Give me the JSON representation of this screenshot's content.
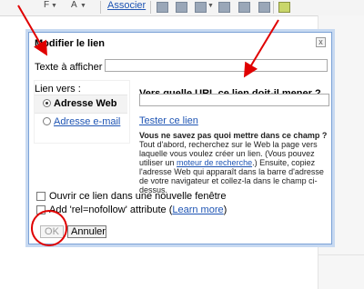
{
  "toolbar": {
    "size_glyph": "F",
    "color_glyph": "A",
    "link_label": "Associer",
    "caret": "▼"
  },
  "dialog": {
    "title": "Modifier le lien",
    "close_glyph": "x",
    "text_to_display_label": "Texte à afficher :",
    "text_to_display_value": "",
    "link_to_label": "Lien vers :",
    "options": [
      {
        "label": "Adresse Web",
        "selected": true
      },
      {
        "label": "Adresse e-mail",
        "selected": false
      }
    ],
    "url_question": "Vers quelle URL ce lien doit-il mener ?",
    "url_value": "",
    "test_link": "Tester ce lien",
    "help": {
      "bold": "Vous ne savez pas quoi mettre dans ce champ ?",
      "part1": " Tout d'abord, recherchez sur le Web la page vers laquelle vous voulez créer un lien. (Vous pouvez utiliser un ",
      "link": "moteur de recherche",
      "part2": ".) Ensuite, copiez l'adresse Web qui apparaît dans la barre d'adresse de votre navigateur et collez-la dans le champ ci-dessus."
    },
    "new_window_label": "Ouvrir ce lien dans une nouvelle fenêtre",
    "nofollow_label": "Add 'rel=nofollow' attribute (",
    "nofollow_link": "Learn more",
    "nofollow_suffix": ")",
    "ok_label": "OK",
    "cancel_label": "Annuler"
  },
  "annotations": {
    "color": "#e00000"
  }
}
